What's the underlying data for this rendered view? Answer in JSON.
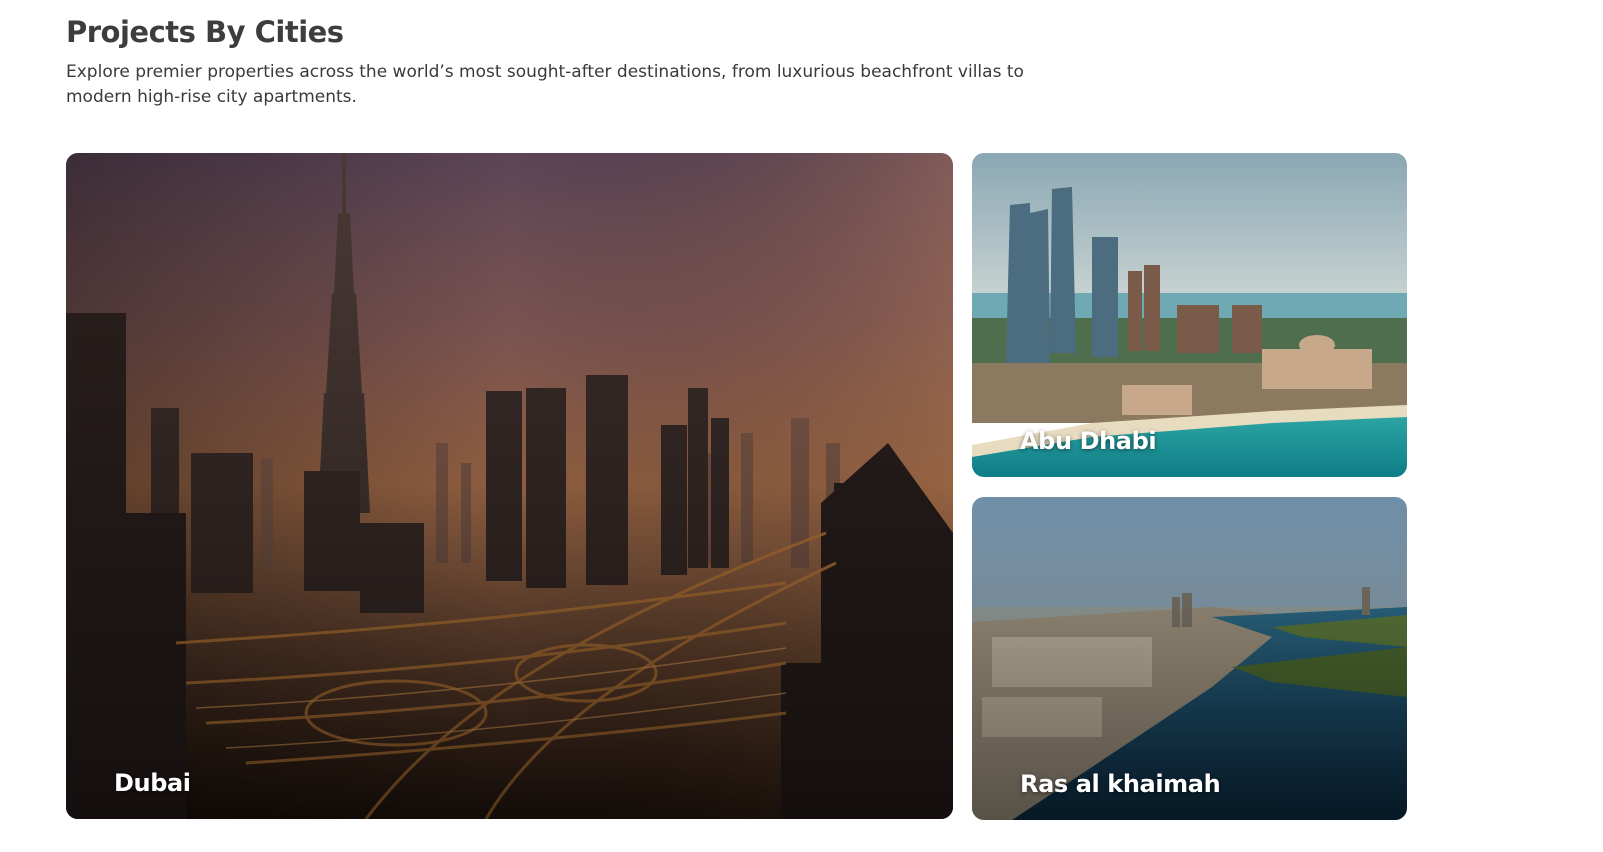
{
  "section": {
    "title": "Projects By Cities",
    "subtitle": "Explore premier properties across the world’s most sought-after destinations, from luxurious beachfront villas to modern high-rise city apartments."
  },
  "cities": [
    {
      "name": "Dubai",
      "image": "dubai-skyline-sunset"
    },
    {
      "name": "Abu Dhabi",
      "image": "abu-dhabi-towers-beach"
    },
    {
      "name": "Ras al khaimah",
      "image": "ras-al-khaimah-creek-aerial"
    }
  ]
}
